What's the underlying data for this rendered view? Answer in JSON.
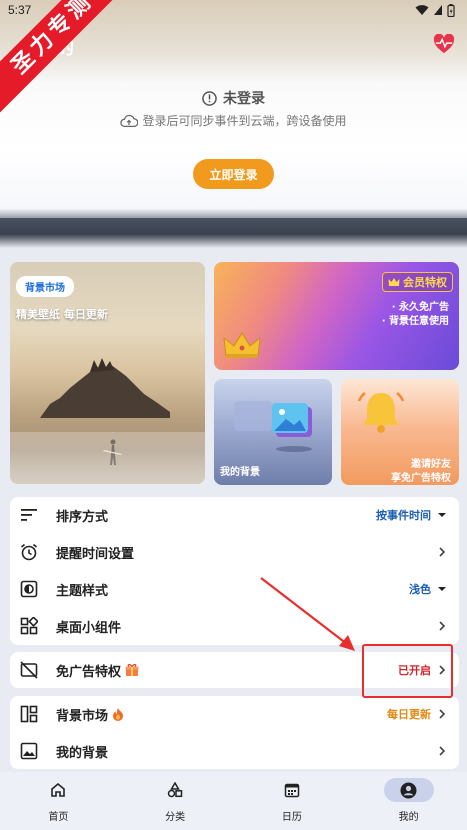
{
  "status_bar": {
    "time": "5:37"
  },
  "watermark": "圣力专测",
  "header": {
    "title": "的"
  },
  "login": {
    "status": "未登录",
    "hint": "登录后可同步事件到云端，跨设备使用",
    "button": "立即登录"
  },
  "cards": {
    "bg_market": {
      "pill": "背景市场",
      "caption": "精美壁纸 每日更新"
    },
    "vip": {
      "tag": "会员特权",
      "perks": [
        "· 永久免广告",
        "· 背景任意使用"
      ]
    },
    "my_bg": {
      "caption": "我的背景"
    },
    "invite": {
      "line1": "邀请好友",
      "line2": "享免广告特权"
    }
  },
  "settings": [
    {
      "label": "排序方式",
      "value": "按事件时间",
      "icon": "sort-icon",
      "trail": "dropdown"
    },
    {
      "label": "提醒时间设置",
      "value": "",
      "icon": "alarm-icon",
      "trail": "chevron"
    },
    {
      "label": "主题样式",
      "value": "浅色",
      "icon": "theme-icon",
      "trail": "dropdown"
    },
    {
      "label": "桌面小组件",
      "value": "",
      "icon": "widget-icon",
      "trail": "chevron"
    }
  ],
  "ad_free": {
    "label": "免广告特权",
    "value": "已开启"
  },
  "more": [
    {
      "label": "背景市场",
      "value": "每日更新",
      "icon": "market-icon"
    },
    {
      "label": "我的背景",
      "value": "",
      "icon": "image-icon"
    }
  ],
  "nav": [
    {
      "label": "首页",
      "icon": "home-icon",
      "active": false
    },
    {
      "label": "分类",
      "icon": "category-icon",
      "active": false
    },
    {
      "label": "日历",
      "icon": "calendar-icon",
      "active": false
    },
    {
      "label": "我的",
      "icon": "profile-icon",
      "active": true
    }
  ],
  "colors": {
    "accent_orange": "#f29a1d",
    "link_blue": "#1a5fb4",
    "alert_red": "#d6262d",
    "watermark_red": "#e51b2a"
  }
}
